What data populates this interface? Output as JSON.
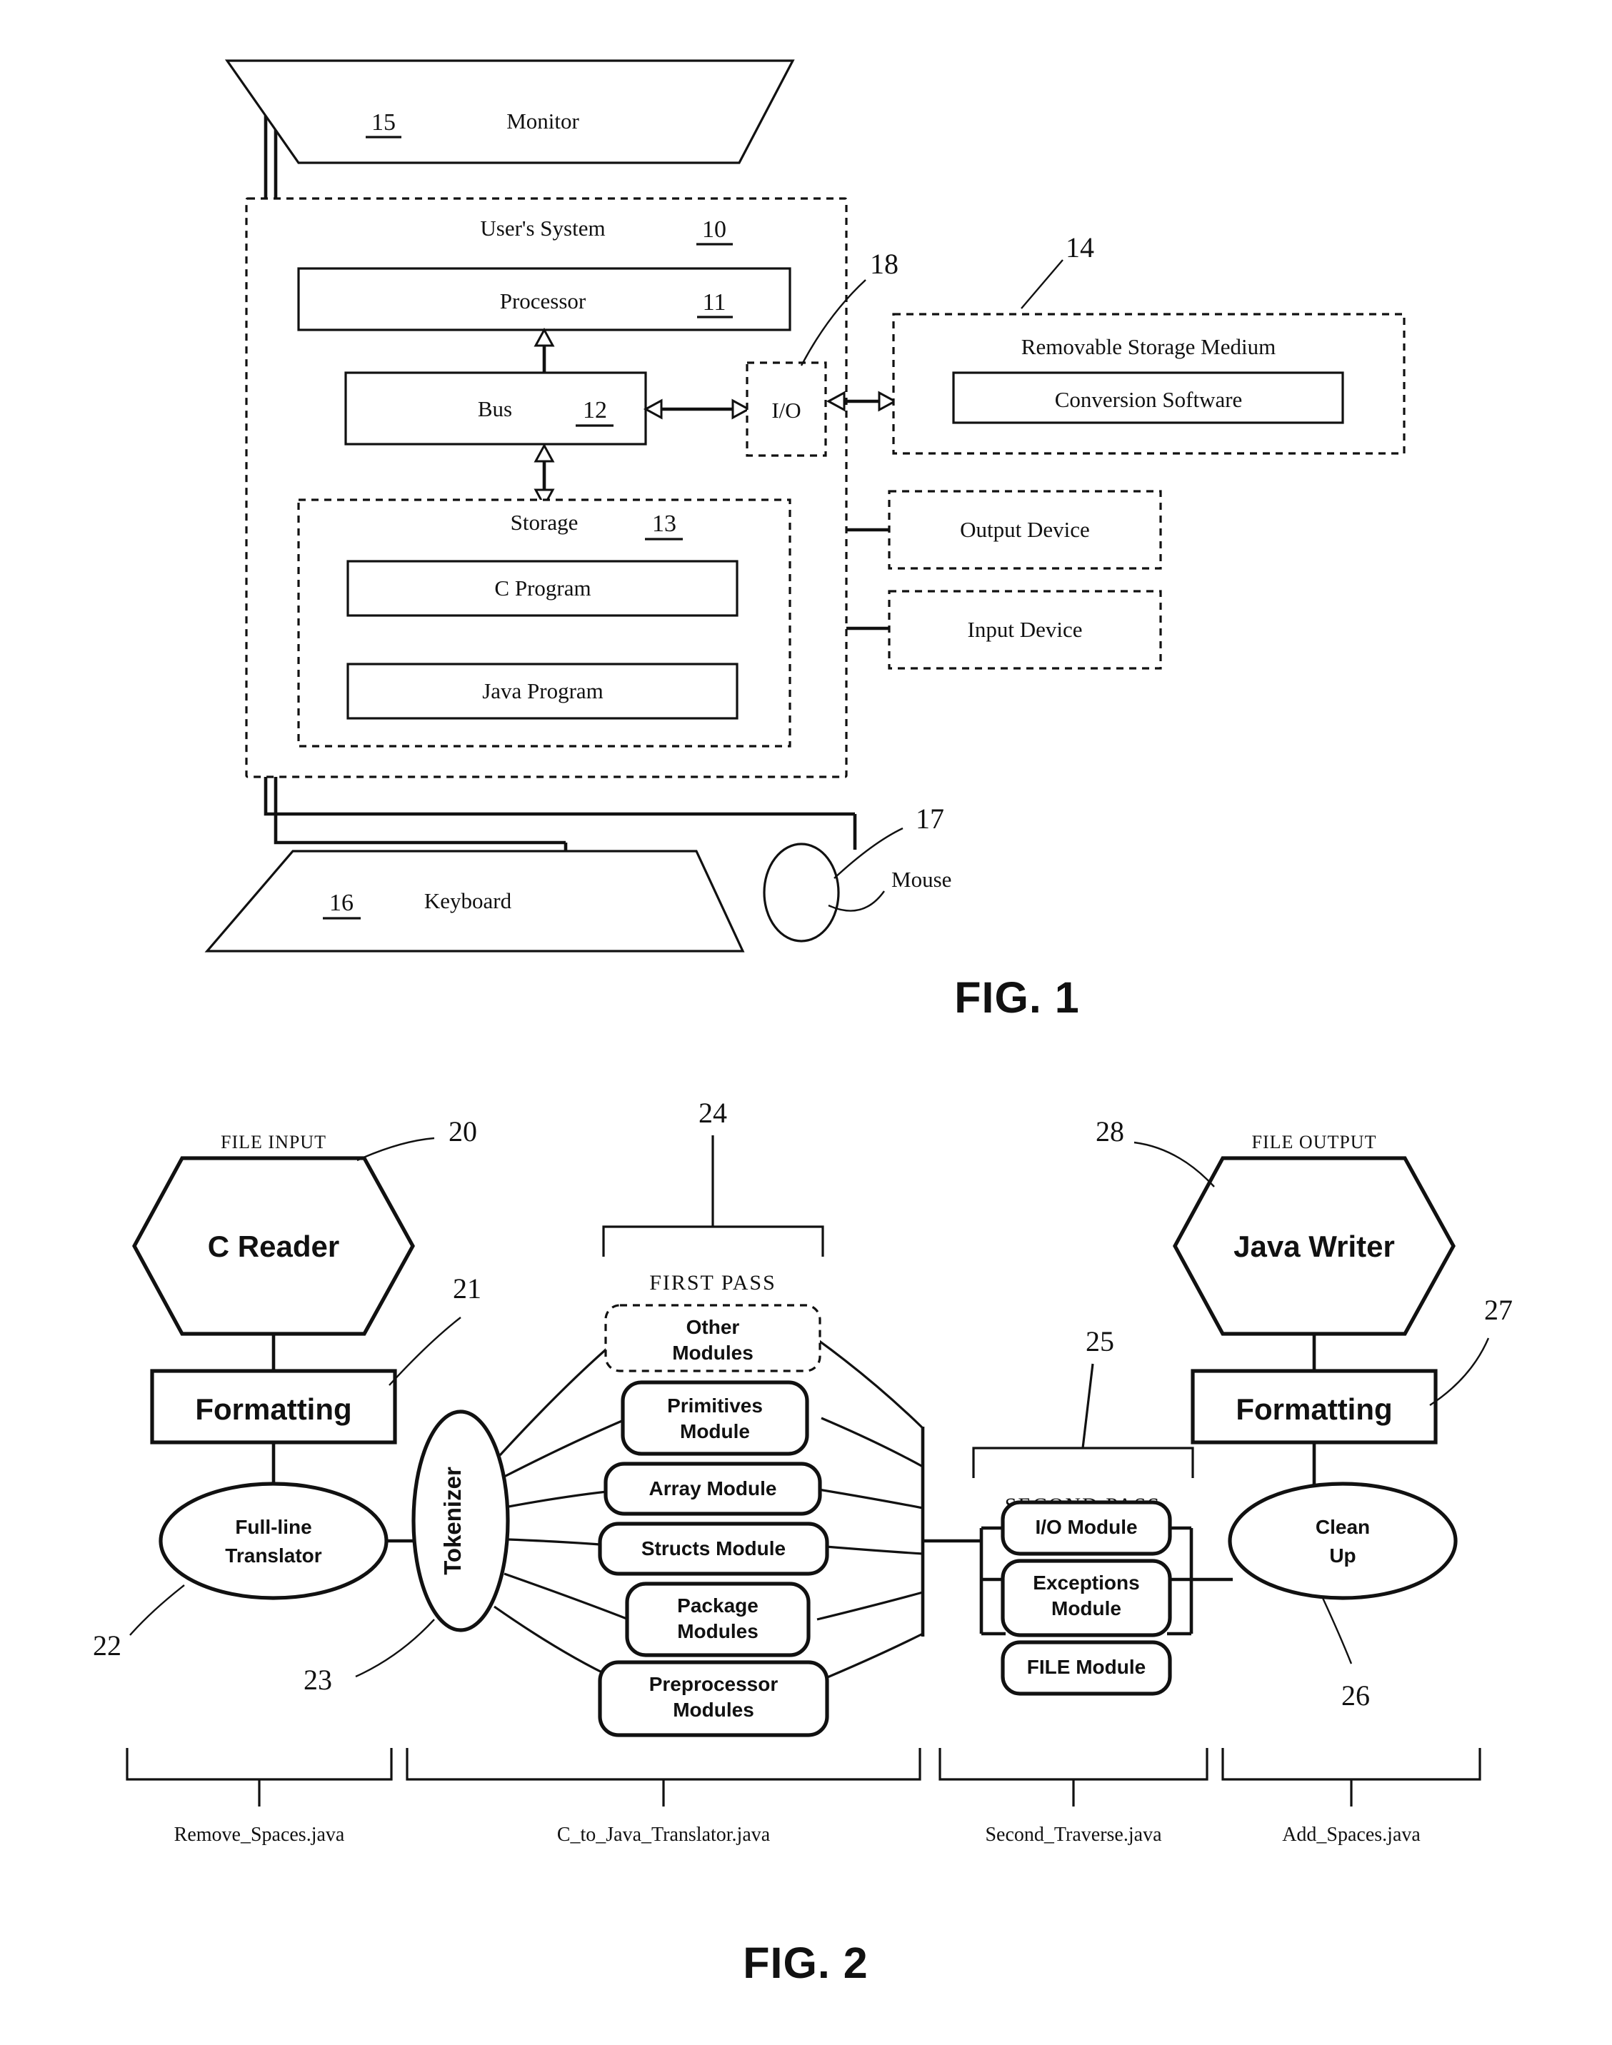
{
  "sheet": {
    "figures": [
      {
        "id": "fig1",
        "caption": "FIG. 1"
      },
      {
        "id": "fig2",
        "caption": "FIG. 2"
      }
    ]
  },
  "fig1": {
    "caption": "FIG. 1",
    "monitor": {
      "label": "Monitor",
      "ref": "15"
    },
    "users_system": {
      "label": "User's System",
      "ref": "10"
    },
    "processor": {
      "label": "Processor",
      "ref": "11"
    },
    "bus": {
      "label": "Bus",
      "ref": "12"
    },
    "io": {
      "label": "I/O",
      "ref": "18"
    },
    "storage": {
      "label": "Storage",
      "ref": "13"
    },
    "c_program": {
      "label": "C Program"
    },
    "java_program": {
      "label": "Java Program"
    },
    "removable_storage": {
      "label": "Removable Storage Medium",
      "ref": "14"
    },
    "conversion_software": {
      "label": "Conversion Software"
    },
    "output_device": {
      "label": "Output Device"
    },
    "input_device": {
      "label": "Input Device"
    },
    "keyboard": {
      "label": "Keyboard",
      "ref": "16"
    },
    "mouse": {
      "label": "Mouse",
      "ref": "17"
    }
  },
  "fig2": {
    "caption": "FIG. 2",
    "file_input": {
      "label": "FILE INPUT"
    },
    "file_output": {
      "label": "FILE OUTPUT"
    },
    "c_reader": {
      "label": "C Reader",
      "ref": "20"
    },
    "formatting_in": {
      "label": "Formatting",
      "ref": "21"
    },
    "full_line_translator": {
      "label_line1": "Full-line",
      "label_line2": "Translator",
      "ref": "22"
    },
    "tokenizer": {
      "label": "Tokenizer",
      "ref": "23"
    },
    "first_pass": {
      "label": "FIRST PASS",
      "ref": "24"
    },
    "second_pass": {
      "label": "SECOND PASS",
      "ref": "25"
    },
    "java_writer": {
      "label": "Java Writer",
      "ref": "28"
    },
    "formatting_out": {
      "label": "Formatting",
      "ref": "27"
    },
    "clean_up": {
      "label_line1": "Clean",
      "label_line2": "Up",
      "ref": "26"
    },
    "first_pass_modules": [
      {
        "id": "other-modules",
        "line1": "Other",
        "line2": "Modules",
        "dashed": true
      },
      {
        "id": "primitives-module",
        "line1": "Primitives",
        "line2": "Module",
        "dashed": false
      },
      {
        "id": "array-module",
        "line1": "Array Module",
        "line2": "",
        "dashed": false
      },
      {
        "id": "structs-module",
        "line1": "Structs Module",
        "line2": "",
        "dashed": false
      },
      {
        "id": "package-modules",
        "line1": "Package",
        "line2": "Modules",
        "dashed": false
      },
      {
        "id": "preprocessor-modules",
        "line1": "Preprocessor",
        "line2": "Modules",
        "dashed": false
      }
    ],
    "second_pass_modules": [
      {
        "id": "io-module",
        "line1": "I/O Module",
        "line2": ""
      },
      {
        "id": "exceptions-module",
        "line1": "Exceptions",
        "line2": "Module"
      },
      {
        "id": "file-module",
        "line1": "FILE Module",
        "line2": ""
      }
    ],
    "file_labels": [
      {
        "id": "remove-spaces",
        "label": "Remove_Spaces.java"
      },
      {
        "id": "c-to-java-translator",
        "label": "C_to_Java_Translator.java"
      },
      {
        "id": "second-traverse",
        "label": "Second_Traverse.java"
      },
      {
        "id": "add-spaces",
        "label": "Add_Spaces.java"
      }
    ]
  },
  "colors": {
    "ink": "#111111",
    "paper": "#ffffff"
  }
}
